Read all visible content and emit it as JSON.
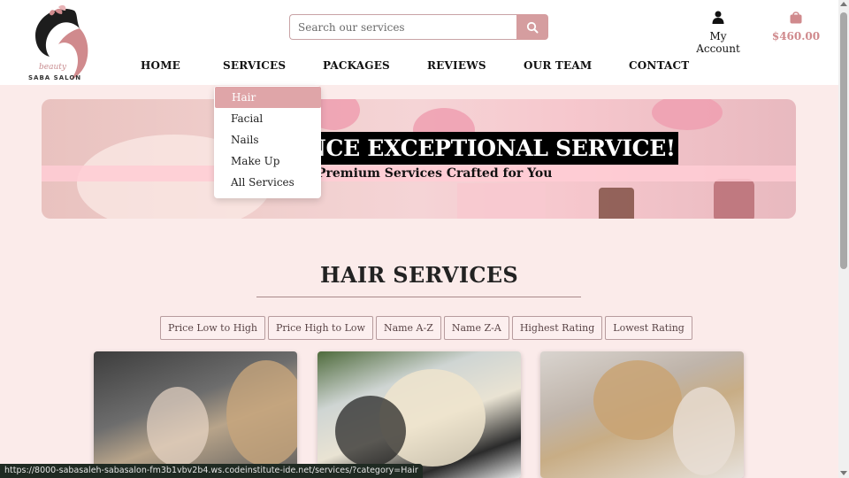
{
  "brand": {
    "logo_script": "beauty",
    "logo_name": "SABA SALON"
  },
  "search": {
    "placeholder": "Search our services",
    "icon": "search-icon"
  },
  "account": {
    "label": "My Account",
    "icon": "user-icon"
  },
  "cart": {
    "amount": "$460.00",
    "icon": "shopping-bag-icon"
  },
  "nav": {
    "items": [
      {
        "label": "HOME"
      },
      {
        "label": "SERVICES"
      },
      {
        "label": "PACKAGES"
      },
      {
        "label": "REVIEWS"
      },
      {
        "label": "OUR TEAM"
      },
      {
        "label": "CONTACT"
      }
    ]
  },
  "services_dropdown": {
    "items": [
      {
        "label": "Hair",
        "active": true
      },
      {
        "label": "Facial"
      },
      {
        "label": "Nails"
      },
      {
        "label": "Make Up"
      },
      {
        "label": "All Services"
      }
    ]
  },
  "hero": {
    "heading": "NCE EXCEPTIONAL SERVICE!",
    "subheading": "Premium Services Crafted for You"
  },
  "main": {
    "title": "HAIR SERVICES",
    "sort_options": [
      "Price Low to High",
      "Price High to Low",
      "Name A-Z",
      "Name Z-A",
      "Highest Rating",
      "Lowest Rating"
    ]
  },
  "status_url": "https://8000-sabasaleh-sabasalon-fm3b1vbv2b4.ws.codeinstitute-ide.net/services/?category=Hair",
  "colors": {
    "accent": "#d59d9f",
    "page_bg": "#fbebea",
    "cart_text": "#d08a8d"
  }
}
